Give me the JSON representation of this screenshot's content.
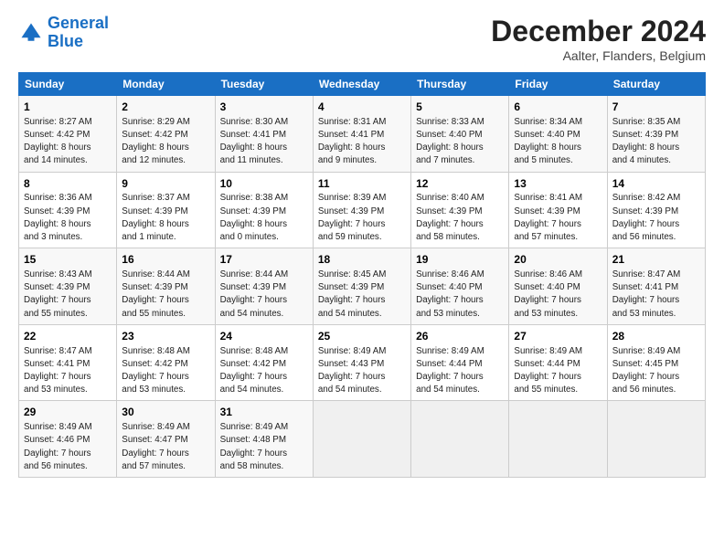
{
  "header": {
    "logo_line1": "General",
    "logo_line2": "Blue",
    "title": "December 2024",
    "subtitle": "Aalter, Flanders, Belgium"
  },
  "weekdays": [
    "Sunday",
    "Monday",
    "Tuesday",
    "Wednesday",
    "Thursday",
    "Friday",
    "Saturday"
  ],
  "weeks": [
    [
      {
        "day": "1",
        "info": "Sunrise: 8:27 AM\nSunset: 4:42 PM\nDaylight: 8 hours\nand 14 minutes."
      },
      {
        "day": "2",
        "info": "Sunrise: 8:29 AM\nSunset: 4:42 PM\nDaylight: 8 hours\nand 12 minutes."
      },
      {
        "day": "3",
        "info": "Sunrise: 8:30 AM\nSunset: 4:41 PM\nDaylight: 8 hours\nand 11 minutes."
      },
      {
        "day": "4",
        "info": "Sunrise: 8:31 AM\nSunset: 4:41 PM\nDaylight: 8 hours\nand 9 minutes."
      },
      {
        "day": "5",
        "info": "Sunrise: 8:33 AM\nSunset: 4:40 PM\nDaylight: 8 hours\nand 7 minutes."
      },
      {
        "day": "6",
        "info": "Sunrise: 8:34 AM\nSunset: 4:40 PM\nDaylight: 8 hours\nand 5 minutes."
      },
      {
        "day": "7",
        "info": "Sunrise: 8:35 AM\nSunset: 4:39 PM\nDaylight: 8 hours\nand 4 minutes."
      }
    ],
    [
      {
        "day": "8",
        "info": "Sunrise: 8:36 AM\nSunset: 4:39 PM\nDaylight: 8 hours\nand 3 minutes."
      },
      {
        "day": "9",
        "info": "Sunrise: 8:37 AM\nSunset: 4:39 PM\nDaylight: 8 hours\nand 1 minute."
      },
      {
        "day": "10",
        "info": "Sunrise: 8:38 AM\nSunset: 4:39 PM\nDaylight: 8 hours\nand 0 minutes."
      },
      {
        "day": "11",
        "info": "Sunrise: 8:39 AM\nSunset: 4:39 PM\nDaylight: 7 hours\nand 59 minutes."
      },
      {
        "day": "12",
        "info": "Sunrise: 8:40 AM\nSunset: 4:39 PM\nDaylight: 7 hours\nand 58 minutes."
      },
      {
        "day": "13",
        "info": "Sunrise: 8:41 AM\nSunset: 4:39 PM\nDaylight: 7 hours\nand 57 minutes."
      },
      {
        "day": "14",
        "info": "Sunrise: 8:42 AM\nSunset: 4:39 PM\nDaylight: 7 hours\nand 56 minutes."
      }
    ],
    [
      {
        "day": "15",
        "info": "Sunrise: 8:43 AM\nSunset: 4:39 PM\nDaylight: 7 hours\nand 55 minutes."
      },
      {
        "day": "16",
        "info": "Sunrise: 8:44 AM\nSunset: 4:39 PM\nDaylight: 7 hours\nand 55 minutes."
      },
      {
        "day": "17",
        "info": "Sunrise: 8:44 AM\nSunset: 4:39 PM\nDaylight: 7 hours\nand 54 minutes."
      },
      {
        "day": "18",
        "info": "Sunrise: 8:45 AM\nSunset: 4:39 PM\nDaylight: 7 hours\nand 54 minutes."
      },
      {
        "day": "19",
        "info": "Sunrise: 8:46 AM\nSunset: 4:40 PM\nDaylight: 7 hours\nand 53 minutes."
      },
      {
        "day": "20",
        "info": "Sunrise: 8:46 AM\nSunset: 4:40 PM\nDaylight: 7 hours\nand 53 minutes."
      },
      {
        "day": "21",
        "info": "Sunrise: 8:47 AM\nSunset: 4:41 PM\nDaylight: 7 hours\nand 53 minutes."
      }
    ],
    [
      {
        "day": "22",
        "info": "Sunrise: 8:47 AM\nSunset: 4:41 PM\nDaylight: 7 hours\nand 53 minutes."
      },
      {
        "day": "23",
        "info": "Sunrise: 8:48 AM\nSunset: 4:42 PM\nDaylight: 7 hours\nand 53 minutes."
      },
      {
        "day": "24",
        "info": "Sunrise: 8:48 AM\nSunset: 4:42 PM\nDaylight: 7 hours\nand 54 minutes."
      },
      {
        "day": "25",
        "info": "Sunrise: 8:49 AM\nSunset: 4:43 PM\nDaylight: 7 hours\nand 54 minutes."
      },
      {
        "day": "26",
        "info": "Sunrise: 8:49 AM\nSunset: 4:44 PM\nDaylight: 7 hours\nand 54 minutes."
      },
      {
        "day": "27",
        "info": "Sunrise: 8:49 AM\nSunset: 4:44 PM\nDaylight: 7 hours\nand 55 minutes."
      },
      {
        "day": "28",
        "info": "Sunrise: 8:49 AM\nSunset: 4:45 PM\nDaylight: 7 hours\nand 56 minutes."
      }
    ],
    [
      {
        "day": "29",
        "info": "Sunrise: 8:49 AM\nSunset: 4:46 PM\nDaylight: 7 hours\nand 56 minutes."
      },
      {
        "day": "30",
        "info": "Sunrise: 8:49 AM\nSunset: 4:47 PM\nDaylight: 7 hours\nand 57 minutes."
      },
      {
        "day": "31",
        "info": "Sunrise: 8:49 AM\nSunset: 4:48 PM\nDaylight: 7 hours\nand 58 minutes."
      },
      null,
      null,
      null,
      null
    ]
  ]
}
